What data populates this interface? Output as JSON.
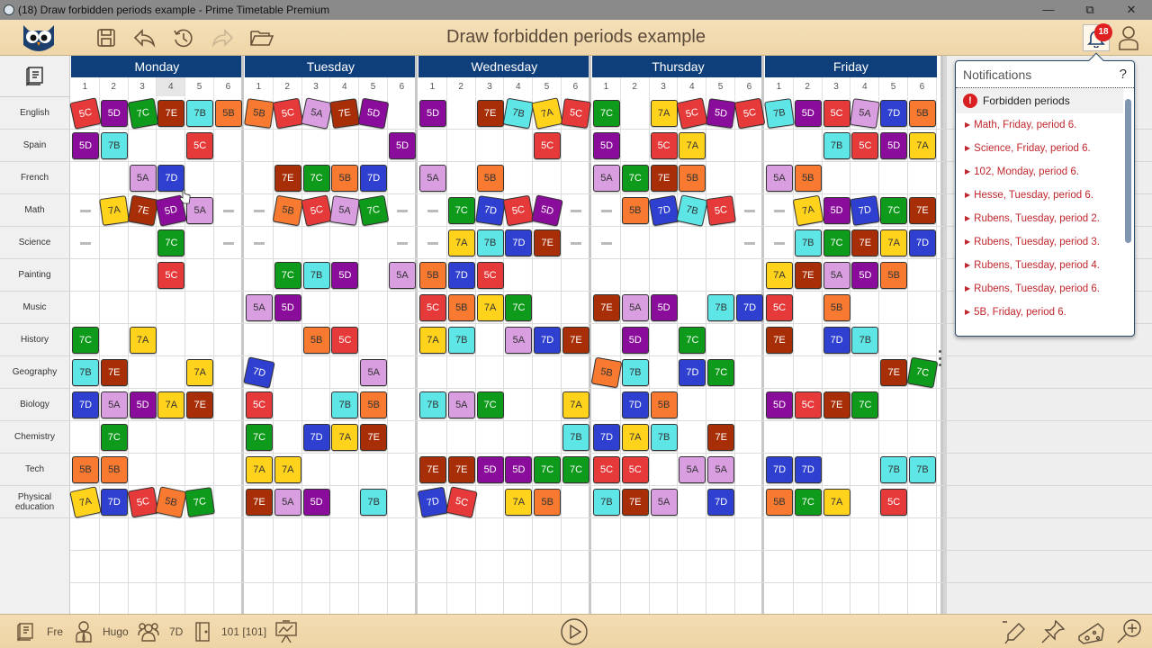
{
  "window": {
    "title": "(18) Draw forbidden periods example - Prime Timetable Premium",
    "controls": [
      "minimize",
      "restore",
      "close"
    ]
  },
  "toolbar": {
    "document_title": "Draw forbidden periods example",
    "buttons": [
      "save",
      "undo",
      "history",
      "redo",
      "open"
    ],
    "notification_count": "18"
  },
  "grid": {
    "days": [
      "Monday",
      "Tuesday",
      "Wednesday",
      "Thursday",
      "Friday"
    ],
    "periods": [
      "1",
      "2",
      "3",
      "4",
      "5",
      "6"
    ],
    "highlighted_period": {
      "day": 0,
      "period": 4
    },
    "subjects": [
      "English",
      "Spain",
      "French",
      "Math",
      "Science",
      "Painting",
      "Music",
      "History",
      "Geography",
      "Biology",
      "Chemistry",
      "Tech",
      "Physical education"
    ],
    "class_colors": {
      "5A": "#d89ee0",
      "5B": "#f77a30",
      "5C": "#e63a3a",
      "5D": "#8a0c9a",
      "7A": "#ffd21c",
      "7B": "#5ee6e6",
      "7C": "#0e9a1a",
      "7D": "#2f3fcf",
      "7E": "#a82e08"
    },
    "dark_text_classes": [
      "5A",
      "5B",
      "7A",
      "7B"
    ],
    "forbidden": [
      {
        "row": 3,
        "day": 0,
        "p": 1
      },
      {
        "row": 3,
        "day": 0,
        "p": 6
      },
      {
        "row": 3,
        "day": 1,
        "p": 1
      },
      {
        "row": 3,
        "day": 1,
        "p": 6
      },
      {
        "row": 3,
        "day": 2,
        "p": 1
      },
      {
        "row": 3,
        "day": 2,
        "p": 6
      },
      {
        "row": 3,
        "day": 3,
        "p": 1
      },
      {
        "row": 3,
        "day": 3,
        "p": 6
      },
      {
        "row": 3,
        "day": 4,
        "p": 1
      },
      {
        "row": 4,
        "day": 0,
        "p": 1
      },
      {
        "row": 4,
        "day": 0,
        "p": 6
      },
      {
        "row": 4,
        "day": 1,
        "p": 1
      },
      {
        "row": 4,
        "day": 1,
        "p": 6
      },
      {
        "row": 4,
        "day": 2,
        "p": 1
      },
      {
        "row": 4,
        "day": 2,
        "p": 6
      },
      {
        "row": 4,
        "day": 3,
        "p": 1
      },
      {
        "row": 4,
        "day": 3,
        "p": 6
      },
      {
        "row": 4,
        "day": 4,
        "p": 1
      }
    ],
    "rows": [
      [
        [
          "5C*",
          "5D",
          "7C*",
          "7E",
          "7B",
          "5B"
        ],
        [
          "5B*",
          "5C*",
          "5A*",
          "7E*",
          "5D*",
          ""
        ],
        [
          "5D",
          "",
          "7E",
          "7B*",
          "7A*",
          "5C*"
        ],
        [
          "7C",
          "",
          "7A",
          "5C*",
          "5D*",
          "5C*"
        ],
        [
          "7B*",
          "5D",
          "5C",
          "5A*",
          "7D",
          "5B"
        ]
      ],
      [
        [
          "5D",
          "7B",
          "",
          "",
          "5C",
          ""
        ],
        [
          "",
          "",
          "",
          "",
          "",
          "5D"
        ],
        [
          "",
          "",
          "",
          "",
          "5C",
          ""
        ],
        [
          "5D",
          "",
          "5C",
          "7A",
          "",
          ""
        ],
        [
          "",
          "",
          "7B",
          "5C",
          "5D",
          "7A"
        ]
      ],
      [
        [
          "",
          "",
          "5A",
          "7D",
          "",
          ""
        ],
        [
          "",
          "7E",
          "7C",
          "5B",
          "7D",
          ""
        ],
        [
          "5A",
          "",
          "5B",
          "",
          "",
          ""
        ],
        [
          "5A",
          "7C",
          "7E",
          "5B",
          "",
          ""
        ],
        [
          "5A",
          "5B",
          "",
          "",
          "",
          ""
        ]
      ],
      [
        [
          "",
          "7A*",
          "7E*",
          "5D*",
          "5A",
          ""
        ],
        [
          "",
          "5B*",
          "5C*",
          "5A*",
          "7C*",
          ""
        ],
        [
          "",
          "7C",
          "7D*",
          "5C*",
          "5D*",
          ""
        ],
        [
          "",
          "5B",
          "7D*",
          "7B*",
          "5C*",
          ""
        ],
        [
          "",
          "7A*",
          "5D",
          "7D*",
          "7C",
          "7E"
        ]
      ],
      [
        [
          "",
          "",
          "",
          "7C",
          "",
          ""
        ],
        [
          "",
          "",
          "",
          "",
          "",
          ""
        ],
        [
          "",
          "7A",
          "7B",
          "7D",
          "7E",
          ""
        ],
        [
          "",
          "",
          "",
          "",
          "",
          ""
        ],
        [
          "",
          "7B",
          "7C",
          "7E",
          "7A",
          "7D"
        ]
      ],
      [
        [
          "",
          "",
          "",
          "5C",
          "",
          ""
        ],
        [
          "",
          "7C",
          "7B",
          "5D",
          "",
          "5A"
        ],
        [
          "5B",
          "7D",
          "5C",
          "",
          "",
          ""
        ],
        [
          "",
          "",
          "",
          "",
          "",
          ""
        ],
        [
          "7A",
          "7E",
          "5A",
          "5D",
          "5B",
          ""
        ]
      ],
      [
        [
          "",
          "",
          "",
          "",
          "",
          ""
        ],
        [
          "5A",
          "5D",
          "",
          "",
          "",
          ""
        ],
        [
          "5C",
          "5B",
          "7A",
          "7C",
          "",
          ""
        ],
        [
          "7E",
          "5A",
          "5D",
          "",
          "7B",
          "7D"
        ],
        [
          "5C",
          "",
          "5B",
          "",
          "",
          ""
        ]
      ],
      [
        [
          "7C",
          "",
          "7A",
          "",
          "",
          ""
        ],
        [
          "",
          "",
          "5B",
          "5C",
          "",
          ""
        ],
        [
          "7A",
          "7B",
          "",
          "5A",
          "7D",
          "7E"
        ],
        [
          "",
          "5D",
          "",
          "7C",
          "",
          ""
        ],
        [
          "7E",
          "",
          "7D",
          "7B",
          "",
          ""
        ]
      ],
      [
        [
          "7B",
          "7E",
          "",
          "",
          "7A",
          ""
        ],
        [
          "7D*",
          "",
          "",
          "",
          "5A",
          ""
        ],
        [
          "",
          "",
          "",
          "",
          "",
          ""
        ],
        [
          "5B*",
          "7B",
          "",
          "7D",
          "7C",
          ""
        ],
        [
          "",
          "",
          "",
          "",
          "7E",
          "7C*"
        ]
      ],
      [
        [
          "7D",
          "5A",
          "5D",
          "7A",
          "7E",
          ""
        ],
        [
          "5C",
          "",
          "",
          "7B",
          "5B",
          ""
        ],
        [
          "7B",
          "5A",
          "7C",
          "",
          "",
          "7A"
        ],
        [
          "",
          "7D",
          "5B",
          "",
          "",
          ""
        ],
        [
          "5D",
          "5C",
          "7E",
          "7C",
          "",
          ""
        ]
      ],
      [
        [
          "",
          "7C",
          "",
          "",
          "",
          ""
        ],
        [
          "7C",
          "",
          "7D",
          "7A",
          "7E",
          ""
        ],
        [
          "",
          "",
          "",
          "",
          "",
          "7B"
        ],
        [
          "7D",
          "7A",
          "7B",
          "",
          "7E",
          ""
        ],
        [
          "",
          "",
          "",
          "",
          "",
          ""
        ]
      ],
      [
        [
          "5B",
          "5B",
          "",
          "",
          "",
          ""
        ],
        [
          "7A",
          "7A",
          "",
          "",
          "",
          ""
        ],
        [
          "7E",
          "7E",
          "5D",
          "5D",
          "7C",
          "7C"
        ],
        [
          "5C",
          "5C",
          "",
          "5A",
          "5A",
          ""
        ],
        [
          "7D",
          "7D",
          "",
          "",
          "7B",
          "7B"
        ]
      ],
      [
        [
          "7A*",
          "7D",
          "5C*",
          "5B*",
          "7C*",
          ""
        ],
        [
          "7E",
          "5A",
          "5D",
          "",
          "7B",
          ""
        ],
        [
          "7D*",
          "5C*",
          "",
          "7A",
          "5B",
          ""
        ],
        [
          "7B",
          "7E",
          "5A",
          "",
          "7D",
          ""
        ],
        [
          "5B",
          "7C",
          "7A",
          "",
          "5C",
          ""
        ]
      ]
    ]
  },
  "notifications": {
    "title": "Notifications",
    "help": "?",
    "category": "Forbidden periods",
    "items": [
      "Math, Friday, period 6.",
      "Science, Friday, period 6.",
      "102, Monday, period 6.",
      "Hesse, Tuesday, period 6.",
      "Rubens, Tuesday, period 2.",
      "Rubens, Tuesday, period 3.",
      "Rubens, Tuesday, period 4.",
      "Rubens, Tuesday, period 6.",
      "5B, Friday, period 6."
    ]
  },
  "statusbar": {
    "subject": "Fre",
    "teacher": "Hugo",
    "class": "7D",
    "room": "101 [101]"
  }
}
